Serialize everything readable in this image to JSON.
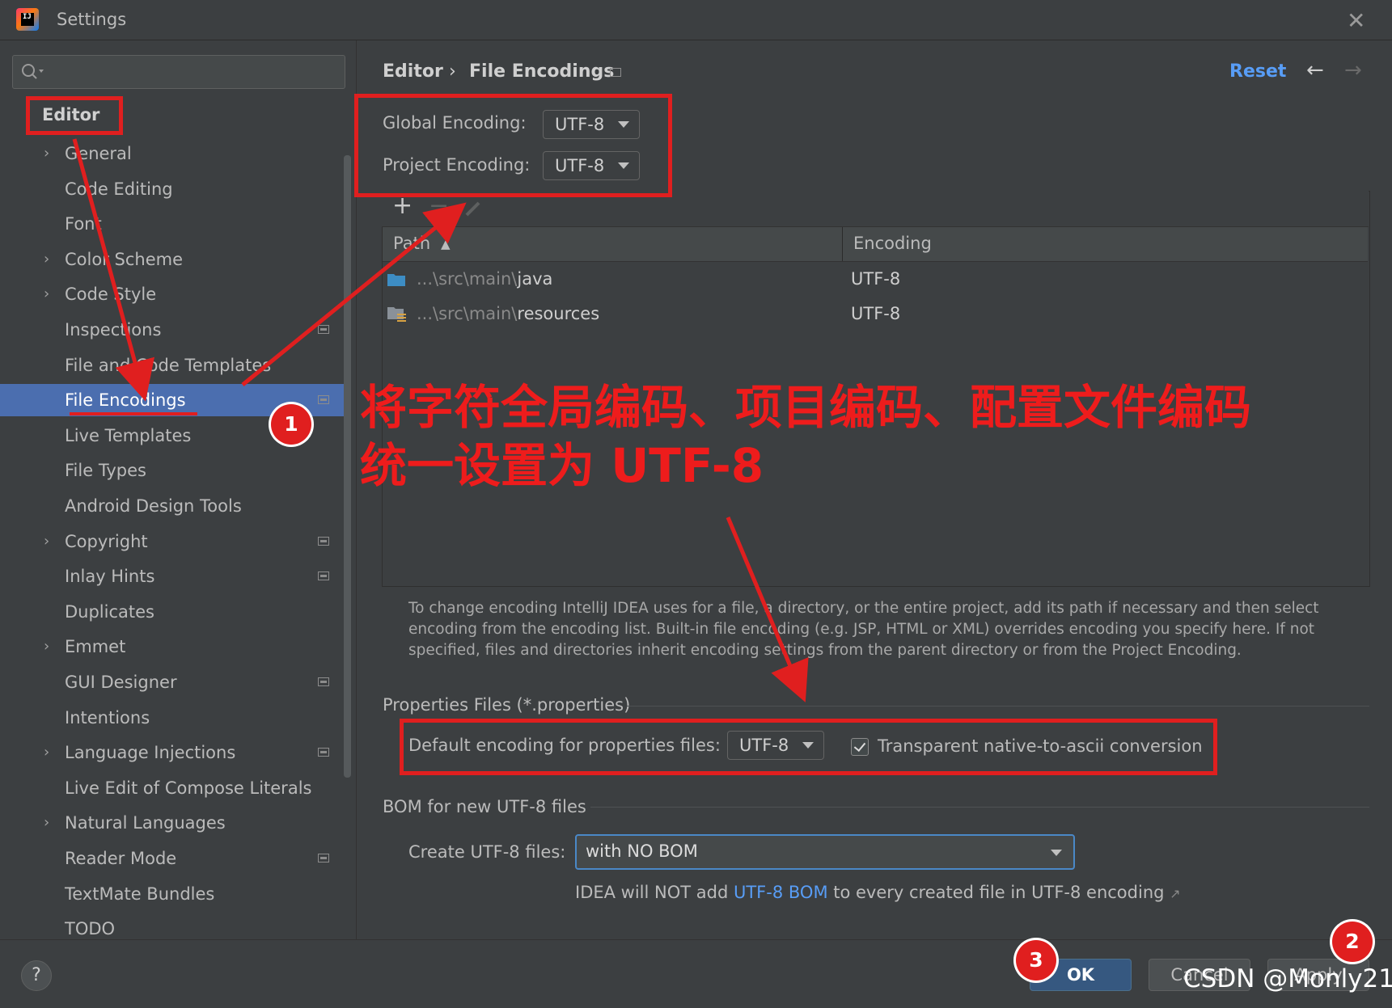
{
  "window": {
    "title": "Settings",
    "app_icon": "intellij-idea-icon",
    "close_icon": "close-icon"
  },
  "sidebar": {
    "search": {
      "placeholder": "",
      "icon": "search-icon"
    },
    "header": "Editor",
    "items": [
      {
        "label": "General",
        "expandable": true,
        "project_scoped": false,
        "selected": false
      },
      {
        "label": "Code Editing",
        "expandable": false,
        "project_scoped": false,
        "selected": false
      },
      {
        "label": "Font",
        "expandable": false,
        "project_scoped": false,
        "selected": false
      },
      {
        "label": "Color Scheme",
        "expandable": true,
        "project_scoped": false,
        "selected": false
      },
      {
        "label": "Code Style",
        "expandable": true,
        "project_scoped": false,
        "selected": false
      },
      {
        "label": "Inspections",
        "expandable": false,
        "project_scoped": true,
        "selected": false
      },
      {
        "label": "File and Code Templates",
        "expandable": false,
        "project_scoped": false,
        "selected": false
      },
      {
        "label": "File Encodings",
        "expandable": false,
        "project_scoped": true,
        "selected": true
      },
      {
        "label": "Live Templates",
        "expandable": false,
        "project_scoped": false,
        "selected": false
      },
      {
        "label": "File Types",
        "expandable": false,
        "project_scoped": false,
        "selected": false
      },
      {
        "label": "Android Design Tools",
        "expandable": false,
        "project_scoped": false,
        "selected": false
      },
      {
        "label": "Copyright",
        "expandable": true,
        "project_scoped": true,
        "selected": false
      },
      {
        "label": "Inlay Hints",
        "expandable": false,
        "project_scoped": true,
        "selected": false
      },
      {
        "label": "Duplicates",
        "expandable": false,
        "project_scoped": false,
        "selected": false
      },
      {
        "label": "Emmet",
        "expandable": true,
        "project_scoped": false,
        "selected": false
      },
      {
        "label": "GUI Designer",
        "expandable": false,
        "project_scoped": true,
        "selected": false
      },
      {
        "label": "Intentions",
        "expandable": false,
        "project_scoped": false,
        "selected": false
      },
      {
        "label": "Language Injections",
        "expandable": true,
        "project_scoped": true,
        "selected": false
      },
      {
        "label": "Live Edit of Compose Literals",
        "expandable": false,
        "project_scoped": false,
        "selected": false
      },
      {
        "label": "Natural Languages",
        "expandable": true,
        "project_scoped": false,
        "selected": false
      },
      {
        "label": "Reader Mode",
        "expandable": false,
        "project_scoped": true,
        "selected": false
      },
      {
        "label": "TextMate Bundles",
        "expandable": false,
        "project_scoped": false,
        "selected": false
      },
      {
        "label": "TODO",
        "expandable": false,
        "project_scoped": false,
        "selected": false
      }
    ]
  },
  "content": {
    "breadcrumb": {
      "parent": "Editor",
      "separator": "›",
      "current": "File Encodings"
    },
    "reset_label": "Reset",
    "back_icon": "←",
    "forward_icon": "→",
    "global_encoding": {
      "label": "Global Encoding:",
      "value": "UTF-8"
    },
    "project_encoding": {
      "label": "Project Encoding:",
      "value": "UTF-8"
    },
    "toolbar": {
      "add": "+",
      "remove": "−",
      "edit_icon": "pencil-icon"
    },
    "table": {
      "columns": [
        "Path",
        "Encoding"
      ],
      "sort_indicator": "▲",
      "rows": [
        {
          "prefix": "...\\src\\main\\",
          "name": "java",
          "encoding": "UTF-8",
          "icon": "source-folder-icon"
        },
        {
          "prefix": "...\\src\\main\\",
          "name": "resources",
          "encoding": "UTF-8",
          "icon": "resources-folder-icon"
        }
      ]
    },
    "help_text": "To change encoding IntelliJ IDEA uses for a file, a directory, or the entire project, add its path if necessary and then select encoding from the encoding list. Built-in file encoding (e.g. JSP, HTML or XML) overrides encoding you specify here. If not specified, files and directories inherit encoding settings from the parent directory or from the Project Encoding.",
    "properties": {
      "group_title": "Properties Files (*.properties)",
      "default_label": "Default encoding for properties files:",
      "default_value": "UTF-8",
      "transparent_label": "Transparent native-to-ascii conversion",
      "transparent_checked": true
    },
    "bom": {
      "group_title": "BOM for new UTF-8 files",
      "create_label": "Create UTF-8 files:",
      "create_value": "with NO BOM",
      "note_pre": "IDEA will NOT add ",
      "note_link": "UTF-8 BOM",
      "note_post": " to every created file in UTF-8 encoding",
      "note_arrow": "↗"
    }
  },
  "footer": {
    "help": "?",
    "ok": "OK",
    "cancel": "Cancel",
    "apply": "Apply"
  },
  "annotations": {
    "line1": "将字符全局编码、项目编码、配置文件编码",
    "line2": "统一设置为 UTF-8",
    "badge1": "1",
    "badge2": "2",
    "badge3": "3",
    "watermark": "CSDN @Monly21"
  },
  "colors": {
    "accent_red": "#e01f1f",
    "selection": "#4b6eaf",
    "link": "#589df6",
    "background": "#3c3f41"
  }
}
